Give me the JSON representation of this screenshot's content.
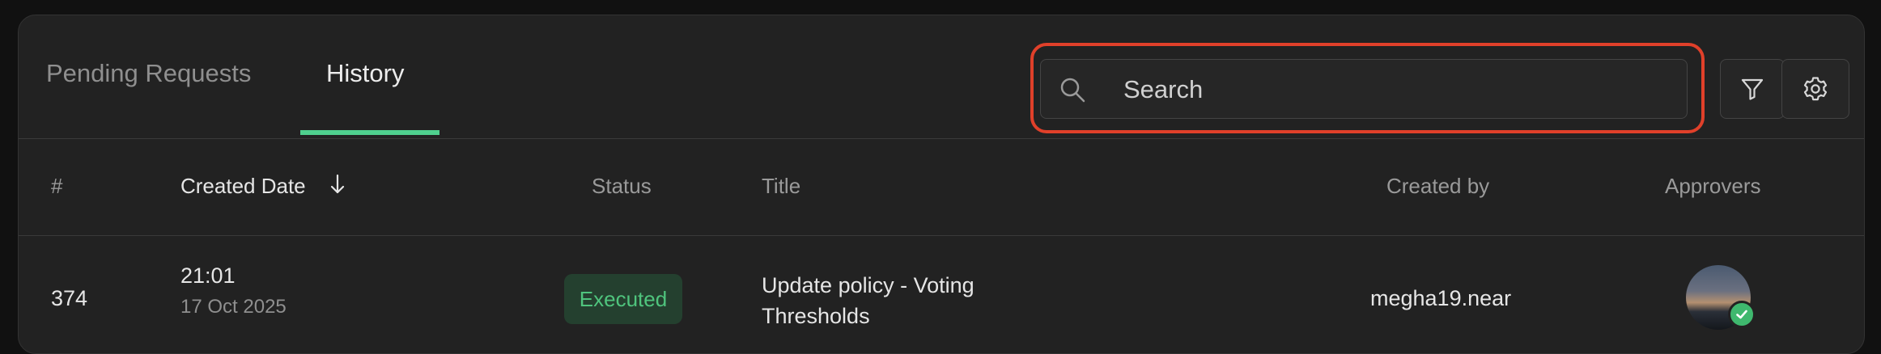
{
  "tabs": {
    "pending": "Pending Requests",
    "history": "History",
    "active": "history"
  },
  "search": {
    "placeholder": "Search",
    "value": ""
  },
  "toolbar": {
    "filter_icon": "filter-icon",
    "settings_icon": "gear-icon"
  },
  "table": {
    "headers": {
      "num": "#",
      "created_date": "Created Date",
      "status": "Status",
      "title": "Title",
      "created_by": "Created by",
      "approvers": "Approvers"
    },
    "sort": {
      "column": "created_date",
      "direction": "descending"
    },
    "rows": [
      {
        "num": "374",
        "time": "21:01",
        "date": "17 Oct 2025",
        "status": "Executed",
        "title": "Update policy - Voting Thresholds",
        "created_by": "megha19.near",
        "approver_approved": true
      }
    ]
  },
  "colors": {
    "accent": "#4fd08e",
    "highlight": "#e0402a",
    "status_executed_bg": "#24402f",
    "status_executed_text": "#4fc47d"
  }
}
